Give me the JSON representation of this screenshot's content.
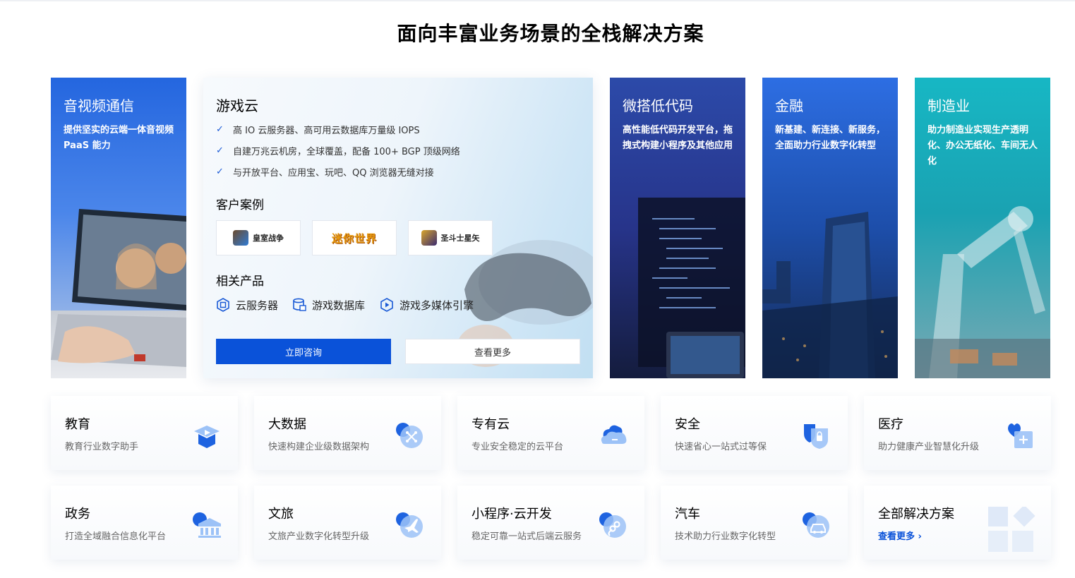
{
  "page": {
    "title": "面向丰富业务场景的全栈解决方案"
  },
  "big_cards": {
    "av": {
      "title": "音视频通信",
      "desc": "提供坚实的云端一体音视频 PaaS 能力"
    },
    "lowcode": {
      "title": "微搭低代码",
      "desc": "高性能低代码开发平台，拖拽式构建小程序及其他应用"
    },
    "finance": {
      "title": "金融",
      "desc": "新基建、新连接、新服务，全面助力行业数字化转型"
    },
    "manufacturing": {
      "title": "制造业",
      "desc": "助力制造业实现生产透明化、办公无纸化、车间无人化"
    }
  },
  "game_card": {
    "title": "游戏云",
    "features": [
      "高 IO 云服务器、高可用云数据库万量级 IOPS",
      "自建万兆云机房，全球覆盖，配备 100+ BGP 顶级网络",
      "与开放平台、应用宝、玩吧、QQ 浏览器无缝对接"
    ],
    "cases_title": "客户案例",
    "cases": [
      "皇室战争",
      "迷你世界",
      "圣斗士星矢"
    ],
    "products_title": "相关产品",
    "products": [
      "云服务器",
      "游戏数据库",
      "游戏多媒体引擎"
    ],
    "consult_label": "立即咨询",
    "more_label": "查看更多"
  },
  "small_cards": [
    {
      "title": "教育",
      "desc": "教育行业数字助手",
      "icon": "graduation-cap-icon"
    },
    {
      "title": "大数据",
      "desc": "快速构建企业级数据架构",
      "icon": "big-data-icon"
    },
    {
      "title": "专有云",
      "desc": "专业安全稳定的云平台",
      "icon": "cloud-icon"
    },
    {
      "title": "安全",
      "desc": "快速省心一站式过等保",
      "icon": "shield-icon"
    },
    {
      "title": "医疗",
      "desc": "助力健康产业智慧化升级",
      "icon": "medical-heart-icon"
    },
    {
      "title": "政务",
      "desc": "打造全域融合信息化平台",
      "icon": "government-building-icon"
    },
    {
      "title": "文旅",
      "desc": "文旅产业数字化转型升级",
      "icon": "airplane-icon"
    },
    {
      "title": "小程序·云开发",
      "desc": "稳定可靠一站式后端云服务",
      "icon": "link-icon"
    },
    {
      "title": "汽车",
      "desc": "技术助力行业数字化转型",
      "icon": "car-icon"
    },
    {
      "title": "全部解决方案",
      "more": "查看更多",
      "icon": "grid-icon"
    }
  ],
  "colors": {
    "brand": "#0a52d9",
    "check": "#1a5ad6"
  }
}
